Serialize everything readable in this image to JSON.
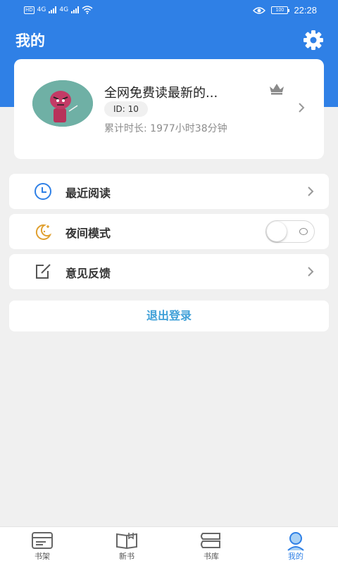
{
  "status_bar": {
    "network_badge": "HD",
    "signal_1": "4G",
    "signal_2": "4G",
    "battery": "100",
    "time": "22:28"
  },
  "header": {
    "title": "我的",
    "settings_icon": "gear-icon"
  },
  "profile": {
    "username": "全网免费读最新的...",
    "id_label": "ID: 10",
    "reading_time": "累计时长: 1977小时38分钟",
    "crown_icon": "crown-icon"
  },
  "menu": {
    "recent": {
      "label": "最近阅读",
      "icon": "clock-icon"
    },
    "night_mode": {
      "label": "夜间模式",
      "icon": "moon-icon",
      "enabled": false
    },
    "feedback": {
      "label": "意见反馈",
      "icon": "edit-icon"
    }
  },
  "logout": {
    "label": "退出登录"
  },
  "bottom_nav": {
    "items": [
      {
        "label": "书架",
        "icon": "bookshelf-icon"
      },
      {
        "label": "新书",
        "icon": "open-book-icon"
      },
      {
        "label": "书库",
        "icon": "library-icon"
      },
      {
        "label": "我的",
        "icon": "user-icon",
        "active": true
      }
    ]
  },
  "colors": {
    "primary": "#2f80e6",
    "background": "#f0f0f0",
    "logout_text": "#3fa0d8",
    "clock_icon": "#2f80e6",
    "moon_icon": "#e0a030"
  }
}
